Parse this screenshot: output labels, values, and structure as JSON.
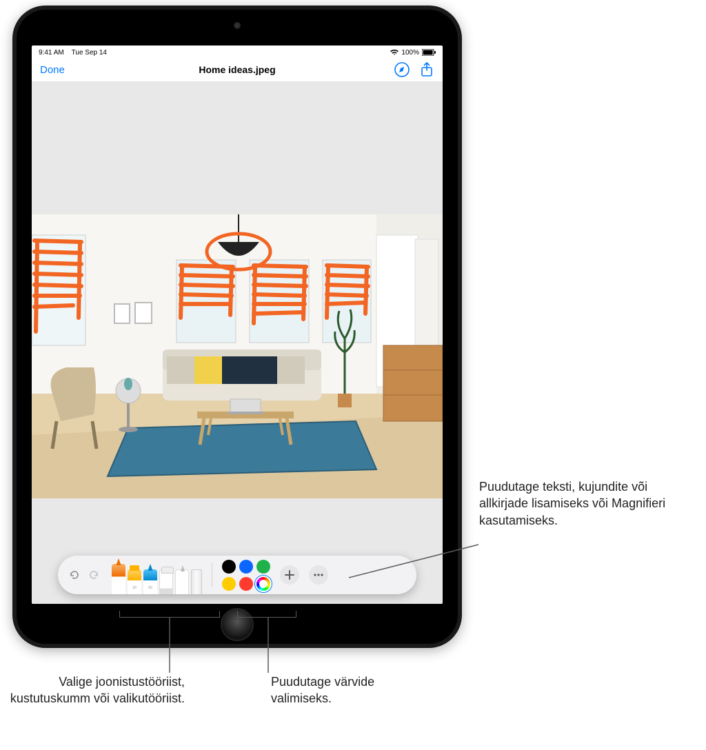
{
  "status_bar": {
    "time": "9:41 AM",
    "date": "Tue Sep 14",
    "battery": "100%"
  },
  "nav": {
    "done": "Done",
    "title": "Home ideas.jpeg"
  },
  "toolbar": {
    "tools": [
      {
        "name": "pen",
        "selected": true
      },
      {
        "name": "marker",
        "selected": false
      },
      {
        "name": "pencil",
        "selected": false
      },
      {
        "name": "eraser",
        "selected": false
      },
      {
        "name": "lasso",
        "selected": false
      },
      {
        "name": "ruler",
        "selected": false
      }
    ],
    "colors": [
      {
        "name": "black",
        "hex": "#000000",
        "selected": false
      },
      {
        "name": "blue",
        "hex": "#0a66ff",
        "selected": false
      },
      {
        "name": "green",
        "hex": "#1fb24b",
        "selected": false
      },
      {
        "name": "yellow",
        "hex": "#ffcc00",
        "selected": false
      },
      {
        "name": "red",
        "hex": "#ff3b30",
        "selected": false
      },
      {
        "name": "multicolor",
        "hex": "multicolor",
        "selected": true
      }
    ]
  },
  "callouts": {
    "add": "Puudutage teksti, kujundite või allkirjade lisamiseks või Magnifieri kasutamiseks.",
    "tools": "Valige joonistustööriist, kustutuskumm või valikutööriist.",
    "colors": "Puudutage värvide valimiseks."
  },
  "accent": "#007aff",
  "markup_color": "#f26522"
}
